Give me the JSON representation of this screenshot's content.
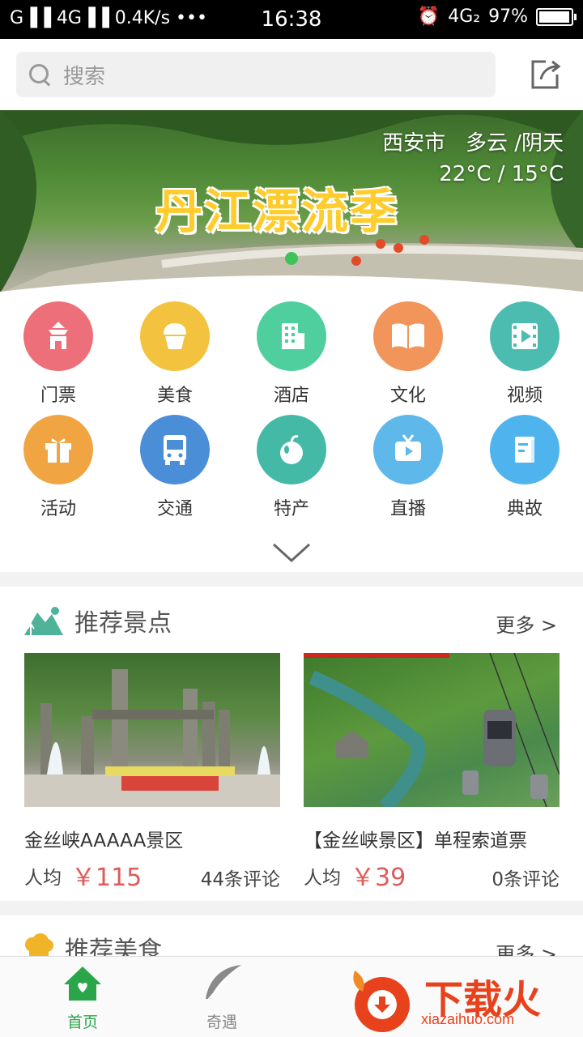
{
  "status_bar": {
    "network_left": "G▐▐ 4G▐▐ 0.4K/s •••",
    "time": "16:38",
    "network_right": "4G₂",
    "battery": "97%",
    "battery_level": 0.97
  },
  "header": {
    "search_placeholder": "搜索",
    "share_icon": "share-icon"
  },
  "banner": {
    "title": "丹江漂流季",
    "city": "西安市",
    "weather": "多云 /阴天",
    "temperature": "22°C / 15°C"
  },
  "grid": {
    "items": [
      {
        "label": "门票",
        "icon": "pagoda-icon",
        "color": "#ec6f7a"
      },
      {
        "label": "美食",
        "icon": "cupcake-icon",
        "color": "#f3c33f"
      },
      {
        "label": "酒店",
        "icon": "building-icon",
        "color": "#4fcf9e"
      },
      {
        "label": "文化",
        "icon": "book-icon",
        "color": "#f2955a"
      },
      {
        "label": "视频",
        "icon": "video-icon",
        "color": "#4cbcb0"
      },
      {
        "label": "活动",
        "icon": "gift-icon",
        "color": "#f0a542"
      },
      {
        "label": "交通",
        "icon": "bus-icon",
        "color": "#4b8ed8"
      },
      {
        "label": "特产",
        "icon": "apple-icon",
        "color": "#43b9a6"
      },
      {
        "label": "直播",
        "icon": "tv-icon",
        "color": "#5fb8ea"
      },
      {
        "label": "典故",
        "icon": "notebook-icon",
        "color": "#4fb4ee"
      }
    ],
    "expand_icon": "chevron-down-icon"
  },
  "scenic": {
    "title": "推荐景点",
    "more": "更多 >",
    "cards": [
      {
        "name": "金丝峡AAAAA景区",
        "per": "人均",
        "price": "￥115",
        "reviews": "44条评论"
      },
      {
        "name": "【金丝峡景区】单程索道票",
        "per": "人均",
        "price": "￥39",
        "reviews": "0条评论"
      }
    ]
  },
  "food": {
    "title": "推荐美食",
    "more": "更多 >"
  },
  "tabbar": {
    "tabs": [
      {
        "label": "首页",
        "icon": "home-icon",
        "active": true,
        "color": "#2aa54a"
      },
      {
        "label": "奇遇",
        "icon": "feather-icon",
        "active": false,
        "color": "#888888"
      }
    ]
  },
  "watermark": {
    "text": "下载火",
    "sub": "xiazaihuo.com"
  }
}
